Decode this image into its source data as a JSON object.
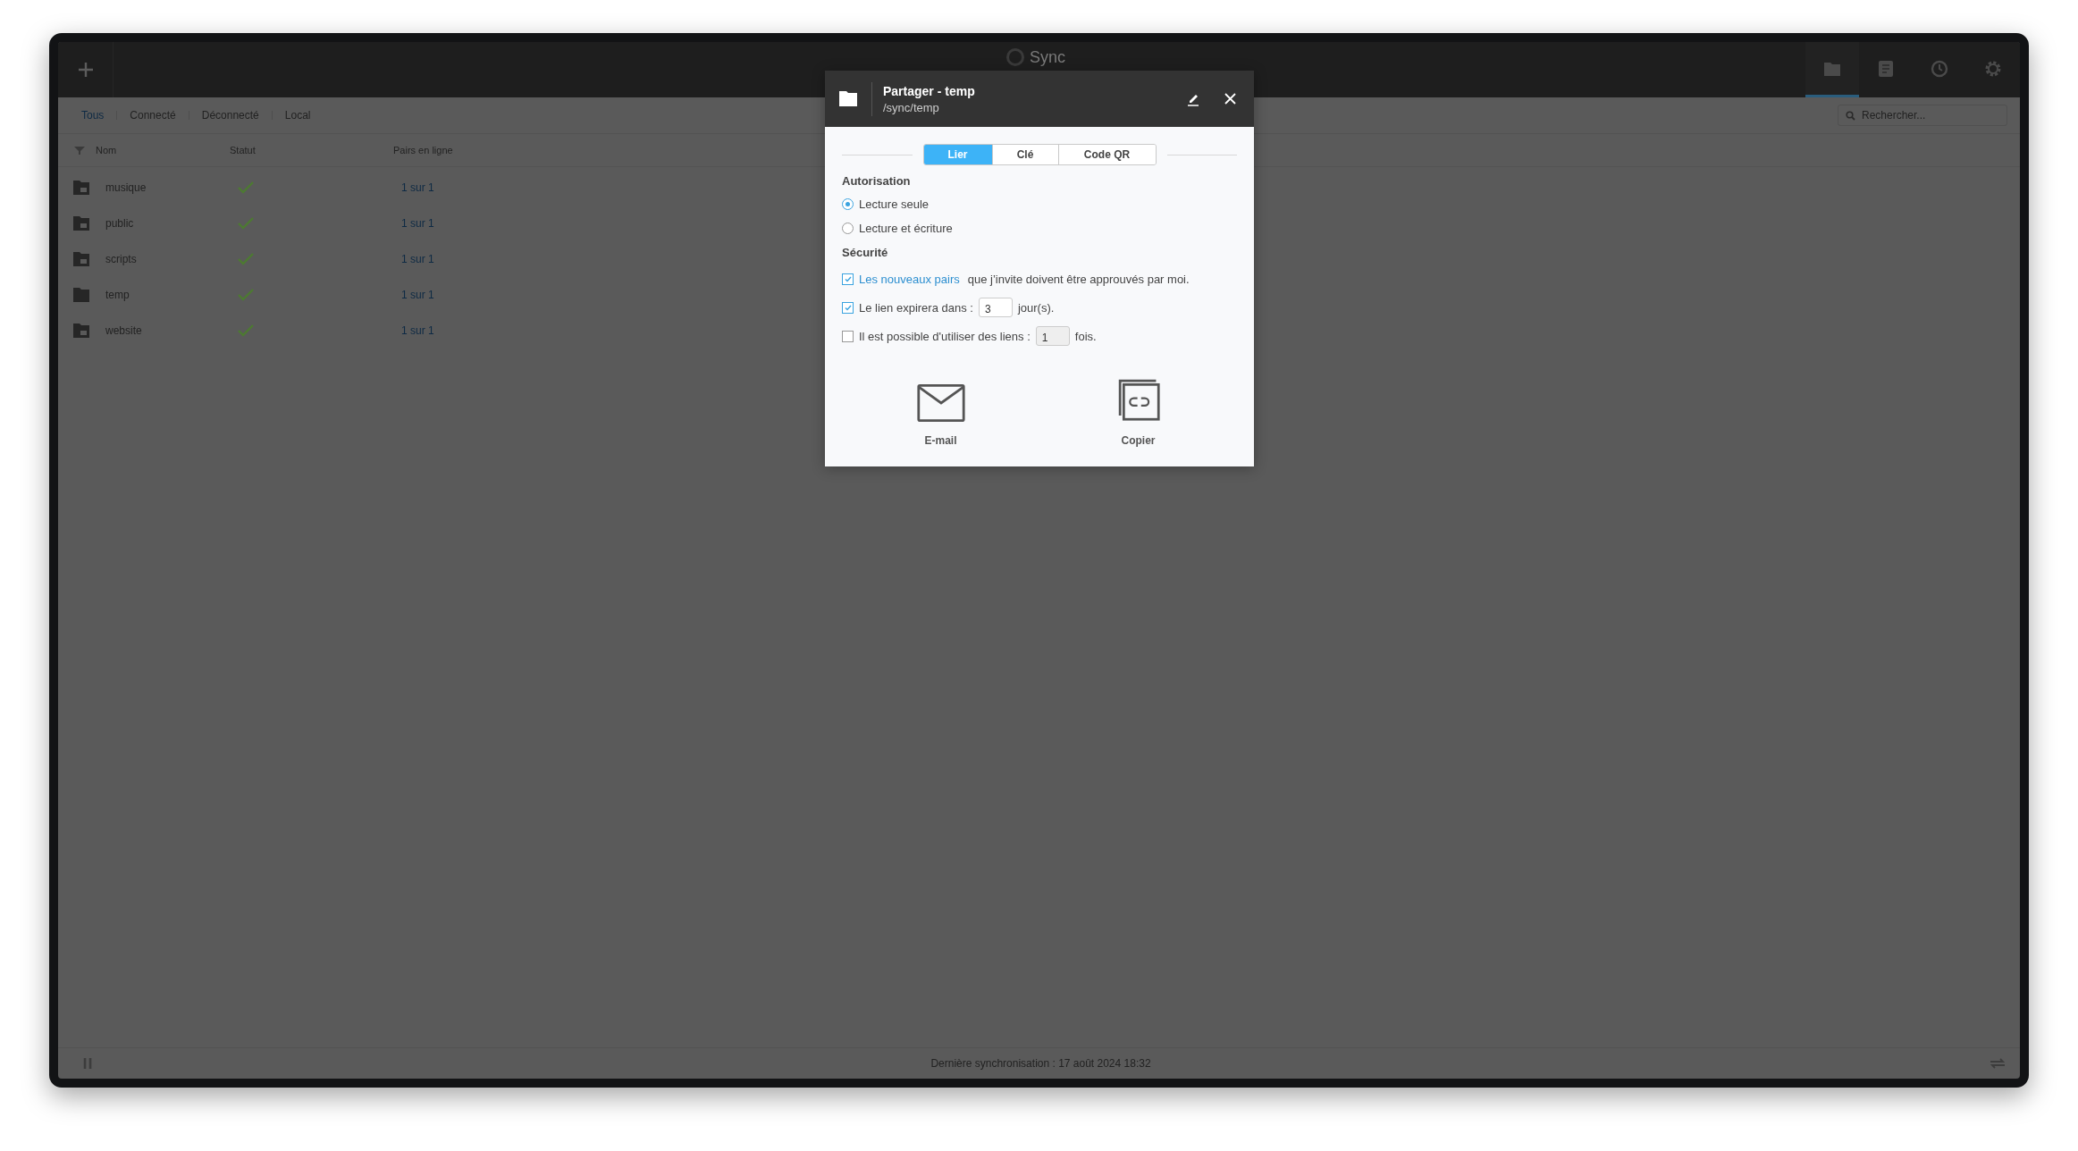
{
  "top_bar": {
    "logo_text": "Sync",
    "nav": [
      {
        "kind": "folders",
        "selected": true
      },
      {
        "kind": "notes",
        "selected": false
      },
      {
        "kind": "history",
        "selected": false
      },
      {
        "kind": "settings",
        "selected": false
      }
    ]
  },
  "filter_tabs": [
    {
      "label": "Tous",
      "selected": true
    },
    {
      "label": "Connecté",
      "selected": false
    },
    {
      "label": "Déconnecté",
      "selected": false
    },
    {
      "label": "Local",
      "selected": false
    }
  ],
  "search": {
    "placeholder": "Rechercher..."
  },
  "table": {
    "columns": [
      "Nom",
      "Statut",
      "Pairs en ligne"
    ],
    "rows": [
      {
        "name": "musique",
        "shared": true,
        "synced": true,
        "peers": "1 sur 1"
      },
      {
        "name": "public",
        "shared": true,
        "synced": true,
        "peers": "1 sur 1"
      },
      {
        "name": "scripts",
        "shared": true,
        "synced": true,
        "peers": "1 sur 1"
      },
      {
        "name": "temp",
        "shared": false,
        "synced": true,
        "peers": "1 sur 1"
      },
      {
        "name": "website",
        "shared": true,
        "synced": true,
        "peers": "1 sur 1"
      }
    ]
  },
  "status_bar": {
    "text": "Dernière synchronisation : 17 août 2024 18:32"
  },
  "dialog": {
    "title": "Partager - temp",
    "path": "/sync/temp",
    "tabs": [
      {
        "label": "Lier",
        "selected": true
      },
      {
        "label": "Clé",
        "selected": false
      },
      {
        "label": "Code QR",
        "selected": false
      }
    ],
    "permission": {
      "heading": "Autorisation",
      "options": [
        {
          "label": "Lecture seule",
          "selected": true
        },
        {
          "label": "Lecture et écriture",
          "selected": false
        }
      ]
    },
    "security": {
      "heading": "Sécurité",
      "options": [
        {
          "kind": "link",
          "checked": true,
          "link": "Les nouveaux pairs",
          "text": "que j’invite doivent être approuvés par moi."
        },
        {
          "kind": "input",
          "checked": true,
          "before": "Le lien expirera dans :",
          "value": "3",
          "after": "jour(s).",
          "disabled": false
        },
        {
          "kind": "input",
          "checked": false,
          "before": "Il est possible d'utiliser des liens :",
          "value": "1",
          "after": "fois.",
          "disabled": true
        }
      ]
    },
    "actions": [
      {
        "kind": "email",
        "label": "E-mail"
      },
      {
        "kind": "copy",
        "label": "Copier"
      }
    ]
  }
}
